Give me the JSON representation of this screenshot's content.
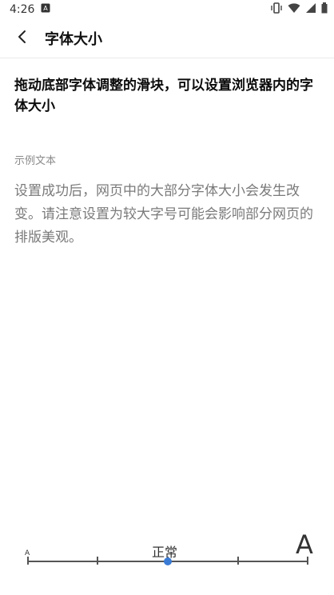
{
  "status_bar": {
    "time": "4:26",
    "icons": [
      "notification-a-icon",
      "vibrate-icon",
      "wifi-icon",
      "signal-icon",
      "battery-icon"
    ]
  },
  "app_bar": {
    "title": "字体大小",
    "back_icon": "back-arrow-icon"
  },
  "content": {
    "headline": "拖动底部字体调整的滑块，可以设置浏览器内的字体大小",
    "section_label": "示例文本",
    "sample_text": "设置成功后，网页中的大部分字体大小会发生改变。请注意设置为较大字号可能会影响部分网页的排版美观。"
  },
  "slider": {
    "min_label": "A",
    "max_label": "A",
    "current_label": "正常",
    "steps": 5,
    "current_step": 2,
    "accent_color": "#3a7bd5"
  }
}
